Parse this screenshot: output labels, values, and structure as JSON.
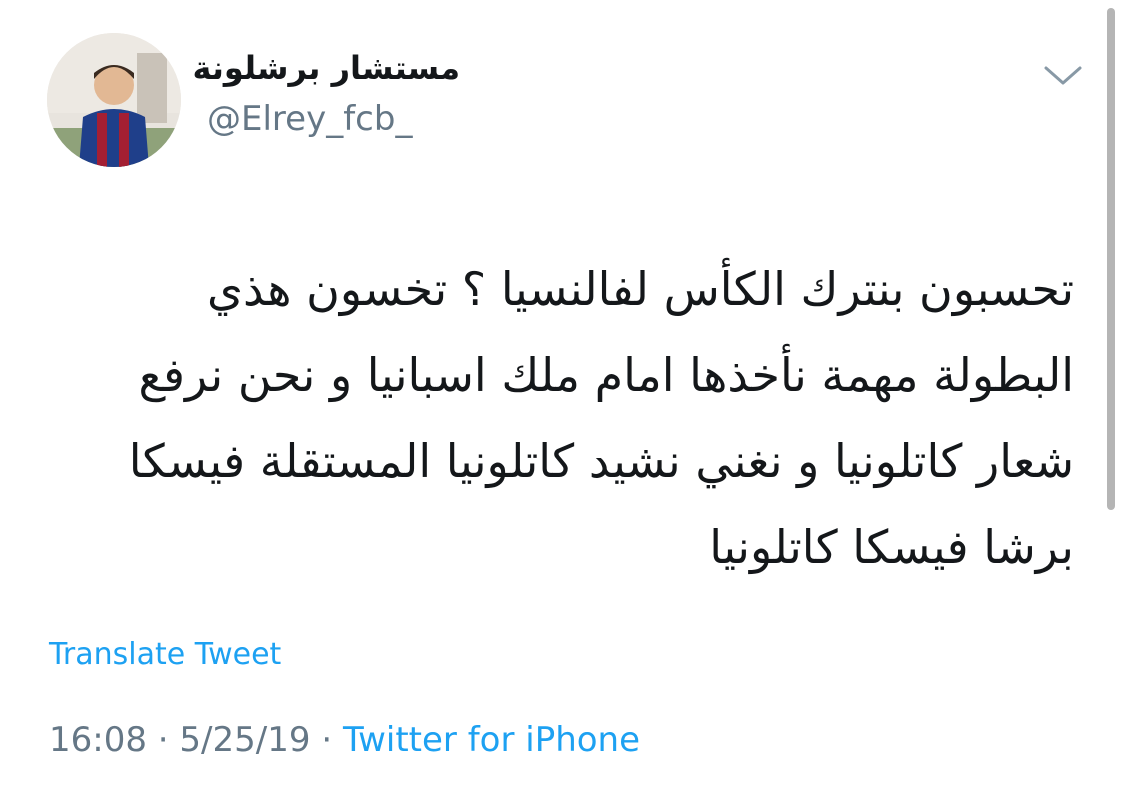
{
  "author": {
    "display_name": "مستشار برشلونة",
    "handle": "@Elrey_fcb_",
    "avatar_icon": "user-avatar-photo"
  },
  "menu": {
    "icon": "chevron-down-icon"
  },
  "tweet": {
    "lines": [
      "تحسبون بنترك الكأس لفالنسيا ؟ تخسون هذي",
      "البطولة مهمة نأخذها امام ملك اسبانيا و نحن نرفع",
      "شعار كاتلونيا و نغني نشيد كاتلونيا المستقلة فيسكا",
      "برشا فيسكا كاتلونيا"
    ]
  },
  "translate_label": "Translate Tweet",
  "meta": {
    "time": "16:08",
    "separator": "·",
    "date": "5/25/19",
    "source": "Twitter for iPhone"
  },
  "colors": {
    "link": "#1da1f2",
    "secondary": "#657786",
    "text": "#14171a"
  }
}
